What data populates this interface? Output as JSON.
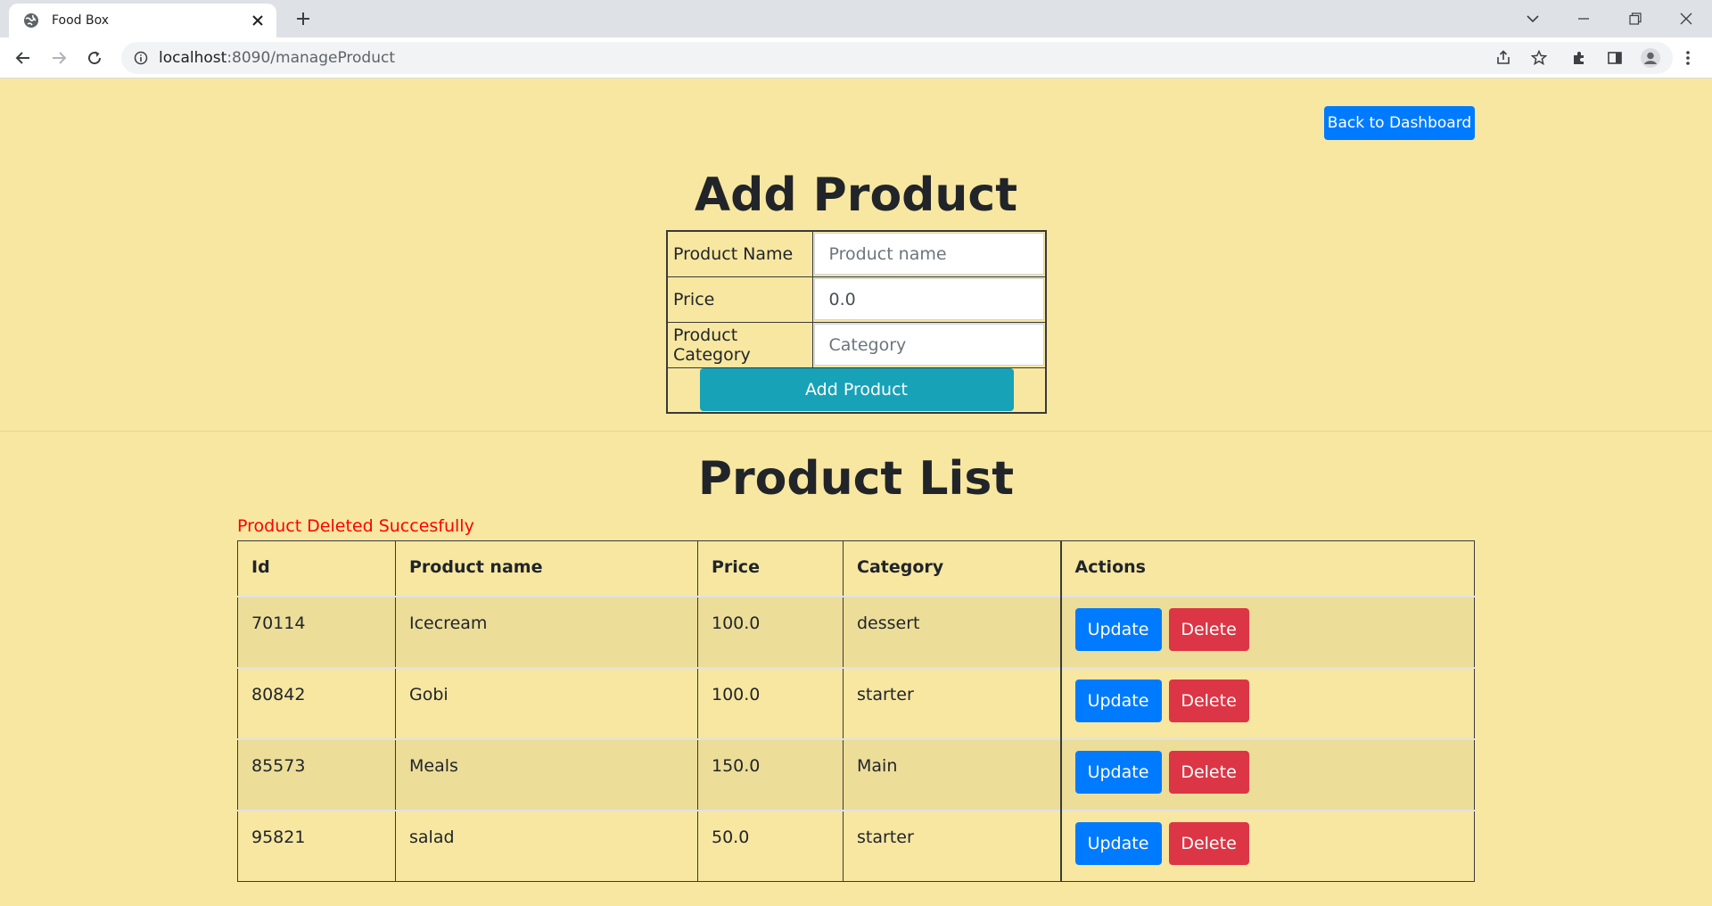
{
  "browser": {
    "tab_title": "Food Box",
    "url_host": "localhost",
    "url_path": ":8090/manageProduct"
  },
  "page": {
    "back_button": "Back to Dashboard",
    "add_heading": "Add Product",
    "form": {
      "name_label": "Product Name",
      "name_placeholder": "Product name",
      "price_label": "Price",
      "price_value": "0.0",
      "category_label": "Product Category",
      "category_placeholder": "Category",
      "submit_label": "Add Product"
    },
    "list_heading": "Product List",
    "status_message": "Product Deleted Succesfully",
    "table": {
      "headers": [
        "Id",
        "Product name",
        "Price",
        "Category",
        "Actions"
      ],
      "rows": [
        {
          "id": "70114",
          "name": "Icecream",
          "price": "100.0",
          "category": "dessert"
        },
        {
          "id": "80842",
          "name": "Gobi",
          "price": "100.0",
          "category": "starter"
        },
        {
          "id": "85573",
          "name": "Meals",
          "price": "150.0",
          "category": "Main"
        },
        {
          "id": "95821",
          "name": "salad",
          "price": "50.0",
          "category": "starter"
        }
      ],
      "update_label": "Update",
      "delete_label": "Delete"
    },
    "colors": {
      "background": "#f7e7a1",
      "primary": "#007bff",
      "info": "#17a2b8",
      "danger": "#dc3545",
      "status_text": "#ff0000"
    }
  }
}
